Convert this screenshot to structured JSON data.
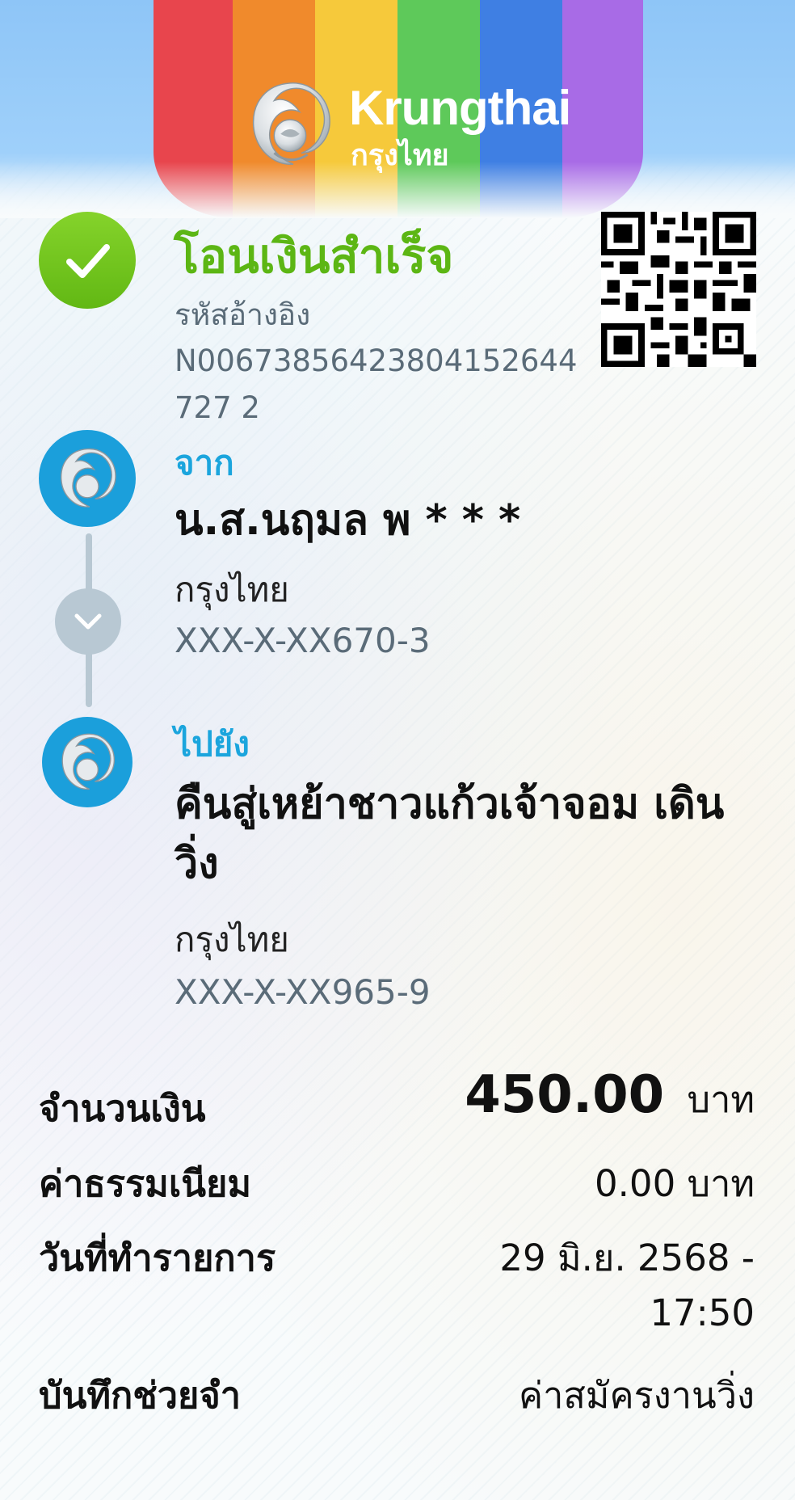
{
  "brand": {
    "name_en": "Krungthai",
    "name_th": "กรุงไทย",
    "stripe_colors": [
      "#e8454d",
      "#f08a2c",
      "#f6c93b",
      "#5ec95a",
      "#3f7fe3",
      "#a86be6"
    ]
  },
  "status": {
    "title": "โอนเงินสำเร็จ",
    "ref_label": "รหัสอ้างอิง",
    "ref_value": "N00673856423804152644727 2",
    "color": "#5cb614"
  },
  "from": {
    "label": "จาก",
    "name": "น.ส.นฤมล พ * * *",
    "bank": "กรุงไทย",
    "account": "XXX-X-XX670-3"
  },
  "to": {
    "label": "ไปยัง",
    "name": "คืนสู่เหย้าชาวแก้วเจ้าจอม เดินวิ่ง",
    "bank": "กรุงไทย",
    "account": "XXX-X-XX965-9"
  },
  "details": {
    "amount_label": "จำนวนเงิน",
    "amount_value": "450.00",
    "amount_unit": "บาท",
    "fee_label": "ค่าธรรมเนียม",
    "fee_value": "0.00 บาท",
    "date_label": "วันที่ทำรายการ",
    "date_value_line1": "29 มิ.ย. 2568 -",
    "date_value_line2": "17:50",
    "memo_label": "บันทึกช่วยจำ",
    "memo_value": "ค่าสมัครงานวิ่ง"
  },
  "icons": {
    "status": "check-icon",
    "qr": "qr-code-icon",
    "avatar": "krungthai-bird-icon",
    "arrow": "chevron-down-icon"
  }
}
